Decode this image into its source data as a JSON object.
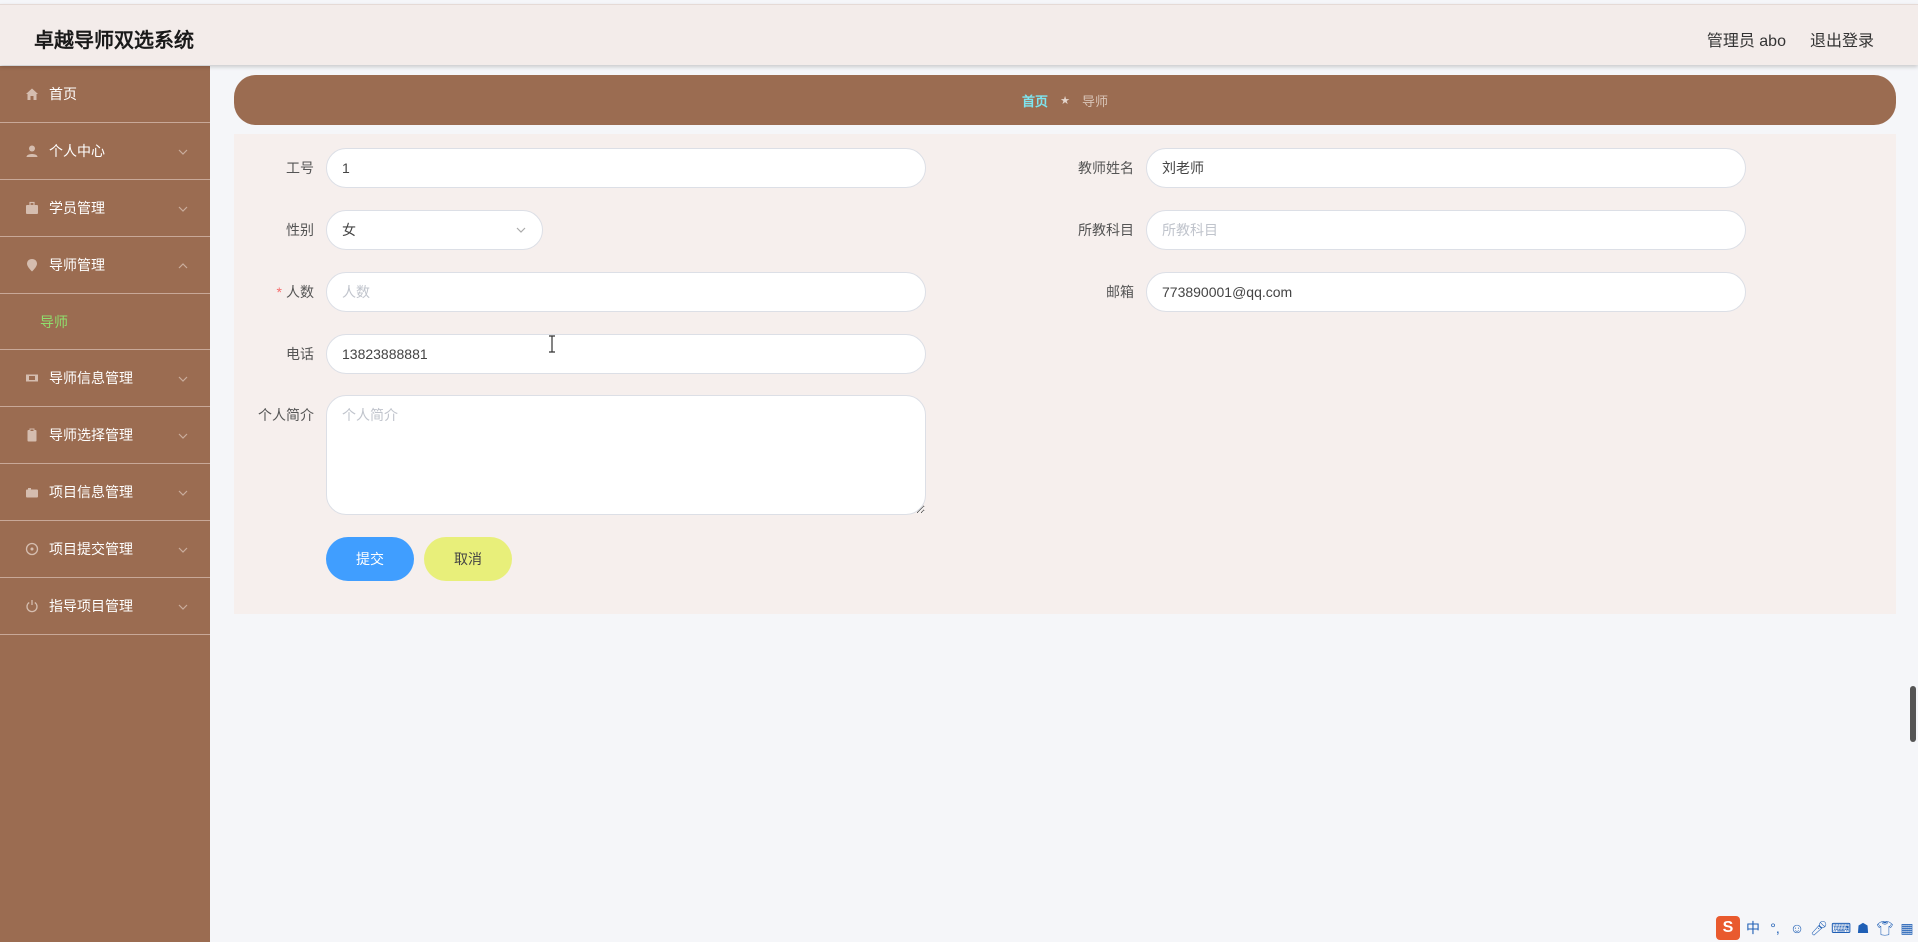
{
  "header": {
    "app_title": "卓越导师双选系统",
    "user_label": "管理员 abo",
    "logout_label": "退出登录"
  },
  "sidebar": {
    "items": [
      {
        "label": "首页",
        "icon": "home-icon"
      },
      {
        "label": "个人中心",
        "icon": "user-icon"
      },
      {
        "label": "学员管理",
        "icon": "briefcase-icon"
      },
      {
        "label": "导师管理",
        "icon": "location-pin-icon"
      },
      {
        "label": "导师信息管理",
        "icon": "ticket-icon"
      },
      {
        "label": "导师选择管理",
        "icon": "clipboard-icon"
      },
      {
        "label": "项目信息管理",
        "icon": "camera-icon"
      },
      {
        "label": "项目提交管理",
        "icon": "compass-icon"
      },
      {
        "label": "指导项目管理",
        "icon": "power-icon"
      }
    ],
    "submenu_active": "导师"
  },
  "breadcrumb": {
    "home": "首页",
    "separator": "★",
    "current": "导师"
  },
  "form": {
    "job_no": {
      "label": "工号",
      "value": "1"
    },
    "teacher_name": {
      "label": "教师姓名",
      "value": "刘老师"
    },
    "gender": {
      "label": "性别",
      "value": "女"
    },
    "subject": {
      "label": "所教科目",
      "value": "",
      "placeholder": "所教科目"
    },
    "count": {
      "label": "人数",
      "required_mark": "*",
      "value": "",
      "placeholder": "人数"
    },
    "email": {
      "label": "邮箱",
      "value": "773890001@qq.com"
    },
    "phone": {
      "label": "电话",
      "value": "13823888881"
    },
    "intro": {
      "label": "个人简介",
      "value": "",
      "placeholder": "个人简介"
    },
    "submit_label": "提交",
    "cancel_label": "取消"
  },
  "ime": {
    "logo": "S",
    "mode": "中",
    "punct": "°,"
  }
}
